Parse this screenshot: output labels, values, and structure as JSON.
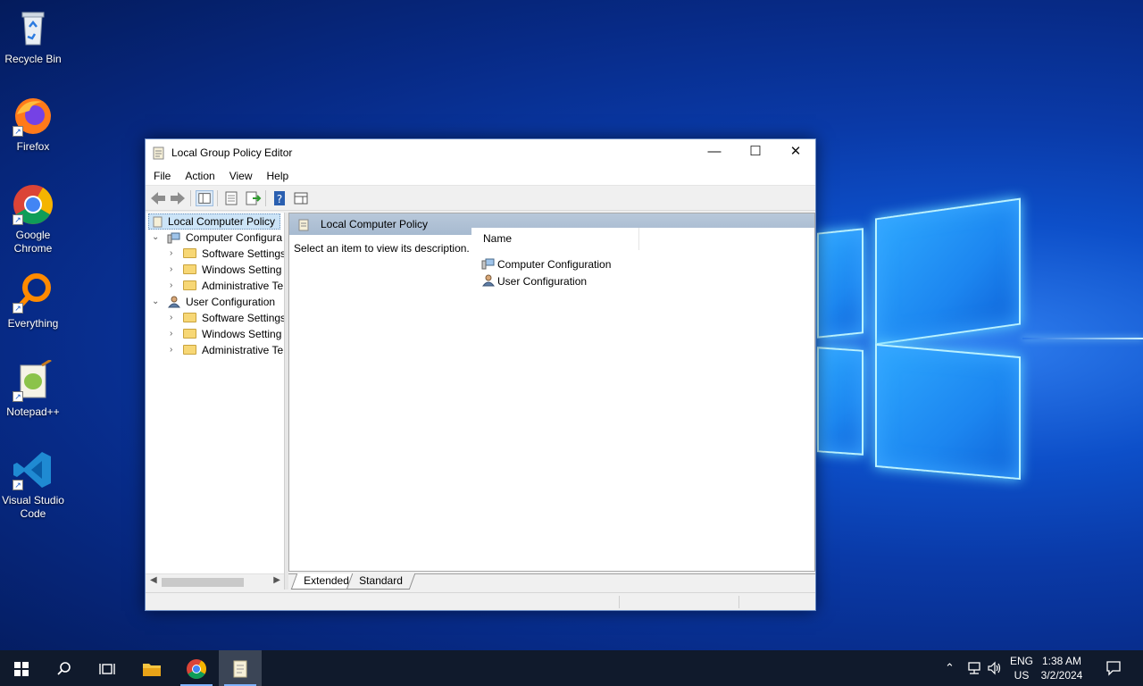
{
  "desktop": {
    "icons": [
      {
        "label": "Recycle Bin"
      },
      {
        "label": "Firefox"
      },
      {
        "label": "Google Chrome"
      },
      {
        "label": "Everything"
      },
      {
        "label": "Notepad++"
      },
      {
        "label": "Visual Studio Code"
      }
    ]
  },
  "window": {
    "title": "Local Group Policy Editor",
    "controls": {
      "minimize": "—",
      "maximize": "☐",
      "close": "✕"
    },
    "menu": [
      "File",
      "Action",
      "View",
      "Help"
    ],
    "tree": {
      "root": "Local Computer Policy",
      "computer": {
        "label": "Computer Configura",
        "children": [
          "Software Settings",
          "Windows Setting",
          "Administrative Te"
        ]
      },
      "user": {
        "label": "User Configuration",
        "children": [
          "Software Settings",
          "Windows Setting",
          "Administrative Te"
        ]
      }
    },
    "main": {
      "header_title": "Local Computer Policy",
      "description": "Select an item to view its description.",
      "column_name": "Name",
      "rows": [
        "Computer Configuration",
        "User Configuration"
      ]
    },
    "tabs": {
      "extended": "Extended",
      "standard": "Standard"
    }
  },
  "taskbar": {
    "tray": {
      "lang_top": "ENG",
      "lang_bottom": "US",
      "time": "1:38 AM",
      "date": "3/2/2024"
    }
  },
  "colors": {
    "accent": "#0a3aa8",
    "taskbar": "#101a2c",
    "selection": "#cce4f7"
  }
}
